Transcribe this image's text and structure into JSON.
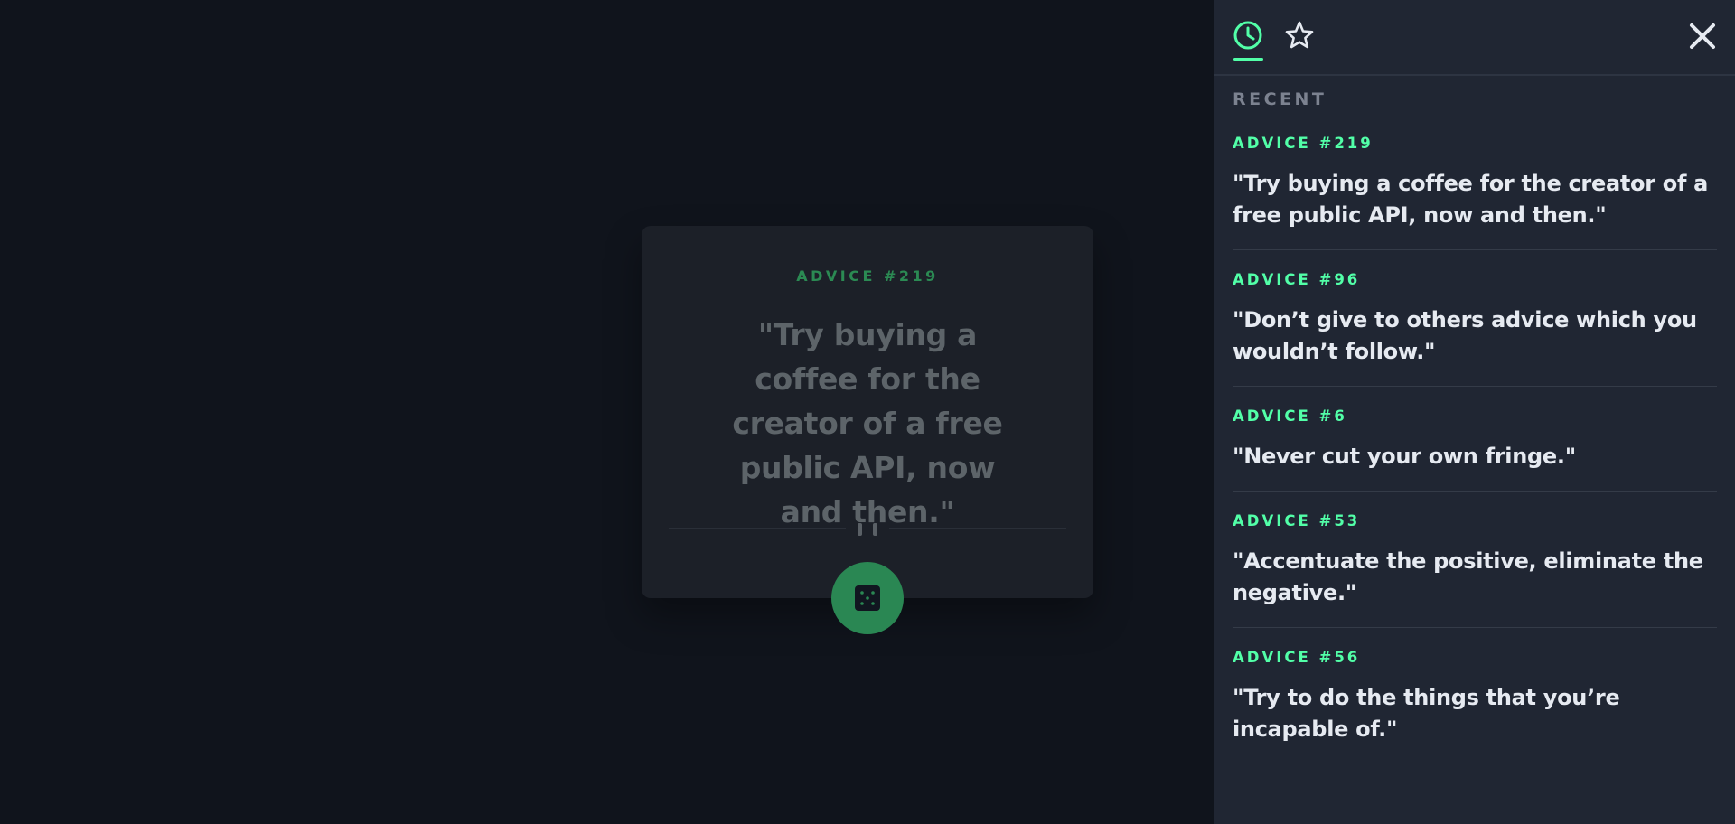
{
  "card": {
    "label": "ADVICE #219",
    "quote": "\"Try buying a coffee for the creator of a free public API, now and then.\"",
    "roll_button_icon": "dice-icon",
    "divider_icon": "pause-icon"
  },
  "sidebar": {
    "tabs": [
      {
        "name": "recent",
        "icon": "clock-icon",
        "active": true
      },
      {
        "name": "favorites",
        "icon": "star-icon",
        "active": false
      }
    ],
    "close_icon": "close-icon",
    "section_title": "RECENT",
    "items": [
      {
        "label": "ADVICE #219",
        "quote": "\"Try buying a coffee for the creator of a free public API, now and then.\""
      },
      {
        "label": "ADVICE #96",
        "quote": "\"Don’t give to others advice which you wouldn’t follow.\""
      },
      {
        "label": "ADVICE #6",
        "quote": "\"Never cut your own fringe.\""
      },
      {
        "label": "ADVICE #53",
        "quote": "\"Accentuate the positive, eliminate the negative.\""
      },
      {
        "label": "ADVICE #56",
        "quote": "\"Try to do the things that you’re incapable of.\""
      }
    ]
  },
  "colors": {
    "accent": "#52ffa8",
    "dim_accent": "#2a8753",
    "background": "#10141c",
    "card": "#1c2028",
    "sidebar": "#202633"
  }
}
